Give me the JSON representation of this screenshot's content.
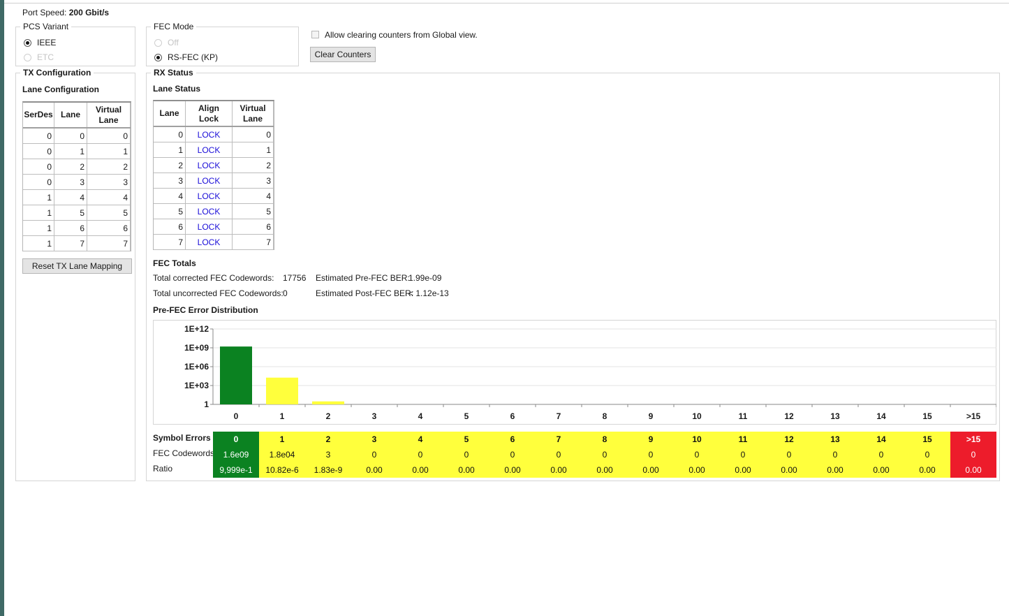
{
  "port_speed": {
    "label": "Port Speed:",
    "value": "200 Gbit/s"
  },
  "pcs_variant": {
    "legend": "PCS Variant",
    "options": [
      {
        "label": "IEEE",
        "selected": true,
        "enabled": true
      },
      {
        "label": "ETC",
        "selected": false,
        "enabled": false
      }
    ]
  },
  "fec_mode": {
    "legend": "FEC Mode",
    "options": [
      {
        "label": "Off",
        "selected": false,
        "enabled": false
      },
      {
        "label": "RS-FEC (KP)",
        "selected": true,
        "enabled": true
      }
    ]
  },
  "allow_clear": {
    "label": "Allow clearing counters from Global view.",
    "checked": false
  },
  "clear_counters_label": "Clear Counters",
  "tx": {
    "legend": "TX Configuration",
    "lane_config_title": "Lane Configuration",
    "headers": [
      "SerDes",
      "Lane",
      "Virtual Lane"
    ],
    "rows": [
      [
        0,
        0,
        0
      ],
      [
        0,
        1,
        1
      ],
      [
        0,
        2,
        2
      ],
      [
        0,
        3,
        3
      ],
      [
        1,
        4,
        4
      ],
      [
        1,
        5,
        5
      ],
      [
        1,
        6,
        6
      ],
      [
        1,
        7,
        7
      ]
    ],
    "reset_label": "Reset TX Lane Mapping"
  },
  "rx": {
    "legend": "RX Status",
    "lane_status_title": "Lane Status",
    "headers": [
      "Lane",
      "Align Lock",
      "Virtual Lane"
    ],
    "rows": [
      [
        0,
        "LOCK",
        0
      ],
      [
        1,
        "LOCK",
        1
      ],
      [
        2,
        "LOCK",
        2
      ],
      [
        3,
        "LOCK",
        3
      ],
      [
        4,
        "LOCK",
        4
      ],
      [
        5,
        "LOCK",
        5
      ],
      [
        6,
        "LOCK",
        6
      ],
      [
        7,
        "LOCK",
        7
      ]
    ]
  },
  "fec_totals": {
    "title": "FEC Totals",
    "corrected_label": "Total corrected FEC Codewords:",
    "corrected_value": "17756",
    "uncorrected_label": "Total uncorrected FEC Codewords:",
    "uncorrected_value": "0",
    "pre_ber_label": "Estimated Pre-FEC BER:",
    "pre_ber_value": "1.99e-09",
    "post_ber_label": "Estimated Post-FEC BER:",
    "post_ber_value": "< 1.12e-13"
  },
  "distribution_title": "Pre-FEC Error Distribution",
  "chart_data": {
    "type": "bar",
    "categories": [
      "0",
      "1",
      "2",
      "3",
      "4",
      "5",
      "6",
      "7",
      "8",
      "9",
      "10",
      "11",
      "12",
      "13",
      "14",
      "15",
      ">15"
    ],
    "values": [
      1600000000,
      18000,
      3,
      0,
      0,
      0,
      0,
      0,
      0,
      0,
      0,
      0,
      0,
      0,
      0,
      0,
      0
    ],
    "log_scale": true,
    "y_ticks": [
      "1",
      "1E+03",
      "1E+06",
      "1E+09",
      "1E+12"
    ],
    "ylim": [
      1,
      1000000000000
    ],
    "bar_colors": [
      "#0b8221",
      "#ffff3c",
      "#ffff3c",
      "#ffff3c",
      "#ffff3c",
      "#ffff3c",
      "#ffff3c",
      "#ffff3c",
      "#ffff3c",
      "#ffff3c",
      "#ffff3c",
      "#ffff3c",
      "#ffff3c",
      "#ffff3c",
      "#ffff3c",
      "#ffff3c",
      "#ed1c2b"
    ],
    "grid": true
  },
  "distribution_table": {
    "row_labels": [
      "Symbol Errors",
      "FEC Codewords",
      "Ratio"
    ],
    "columns": [
      {
        "sym": "0",
        "cw": "1.6e09",
        "ratio": "9,999e-1",
        "color": "g"
      },
      {
        "sym": "1",
        "cw": "1.8e04",
        "ratio": "10.82e-6",
        "color": "y"
      },
      {
        "sym": "2",
        "cw": "3",
        "ratio": "1.83e-9",
        "color": "y"
      },
      {
        "sym": "3",
        "cw": "0",
        "ratio": "0.00",
        "color": "y"
      },
      {
        "sym": "4",
        "cw": "0",
        "ratio": "0.00",
        "color": "y"
      },
      {
        "sym": "5",
        "cw": "0",
        "ratio": "0.00",
        "color": "y"
      },
      {
        "sym": "6",
        "cw": "0",
        "ratio": "0.00",
        "color": "y"
      },
      {
        "sym": "7",
        "cw": "0",
        "ratio": "0.00",
        "color": "y"
      },
      {
        "sym": "8",
        "cw": "0",
        "ratio": "0.00",
        "color": "y"
      },
      {
        "sym": "9",
        "cw": "0",
        "ratio": "0.00",
        "color": "y"
      },
      {
        "sym": "10",
        "cw": "0",
        "ratio": "0.00",
        "color": "y"
      },
      {
        "sym": "11",
        "cw": "0",
        "ratio": "0.00",
        "color": "y"
      },
      {
        "sym": "12",
        "cw": "0",
        "ratio": "0.00",
        "color": "y"
      },
      {
        "sym": "13",
        "cw": "0",
        "ratio": "0.00",
        "color": "y"
      },
      {
        "sym": "14",
        "cw": "0",
        "ratio": "0.00",
        "color": "y"
      },
      {
        "sym": "15",
        "cw": "0",
        "ratio": "0.00",
        "color": "y"
      },
      {
        "sym": ">15",
        "cw": "0",
        "ratio": "0.00",
        "color": "r"
      }
    ]
  }
}
